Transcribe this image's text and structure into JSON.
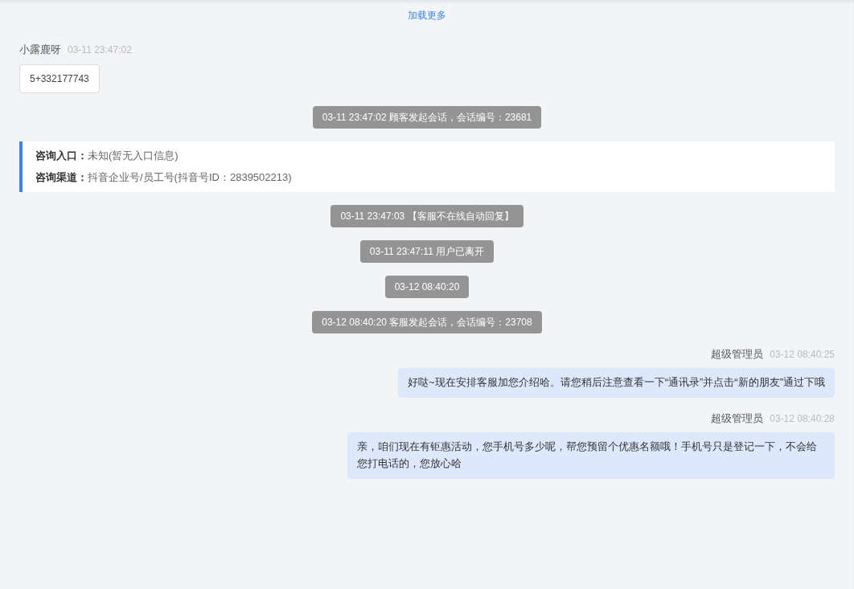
{
  "load_more": "加载更多",
  "messages": [
    {
      "kind": "incoming",
      "sender": "小露鹿呀",
      "time": "03-11 23:47:02",
      "text": "5+332177743"
    },
    {
      "kind": "system",
      "text": "03-11 23:47:02 顾客发起会话，会话编号：23681"
    },
    {
      "kind": "info",
      "rows": [
        {
          "label": "咨询入口：",
          "value": "未知(暂无入口信息)"
        },
        {
          "label": "咨询渠道：",
          "value": "抖音企业号/员工号(抖音号ID：2839502213)"
        }
      ]
    },
    {
      "kind": "system",
      "text": "03-11 23:47:03 【客服不在线自动回复】"
    },
    {
      "kind": "system",
      "text": "03-11 23:47:11 用户已离开"
    },
    {
      "kind": "system",
      "text": "03-12 08:40:20"
    },
    {
      "kind": "system",
      "text": "03-12 08:40:20 客服发起会话，会话编号：23708"
    },
    {
      "kind": "outgoing",
      "sender": "超级管理员",
      "time": "03-12 08:40:25",
      "text": "好哒~现在安排客服加您介绍哈。请您稍后注意查看一下“通讯录”并点击“新的朋友”通过下哦"
    },
    {
      "kind": "outgoing",
      "sender": "超级管理员",
      "time": "03-12 08:40:28",
      "text": "亲，咱们现在有钜惠活动，您手机号多少呢，帮您预留个优惠名额哦！手机号只是登记一下，不会给您打电话的，您放心哈"
    }
  ]
}
